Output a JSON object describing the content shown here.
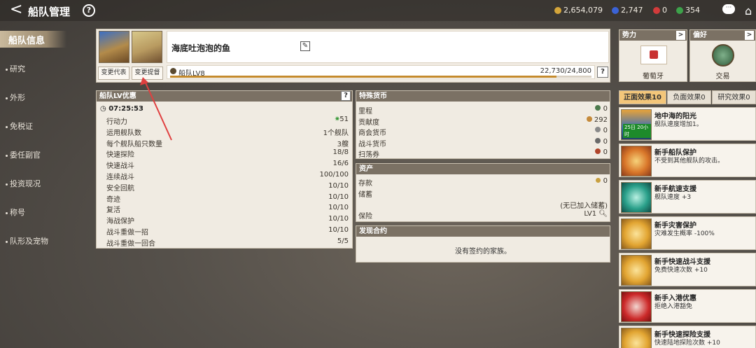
{
  "header": {
    "back_glyph": "<",
    "title": "船队管理",
    "help_glyph": "?",
    "currencies": [
      {
        "icon": "gold-coin-icon",
        "color": "#d4a53a",
        "value": "2,654,079"
      },
      {
        "icon": "blue-gem-icon",
        "color": "#3b63d6",
        "value": "2,747"
      },
      {
        "icon": "red-gem-icon",
        "color": "#d23b3b",
        "value": "0"
      },
      {
        "icon": "green-badge-icon",
        "color": "#3da24a",
        "value": "354"
      }
    ],
    "chat_glyph": "···",
    "home_glyph": "⌂"
  },
  "sidebar": {
    "active": "船队信息",
    "items": [
      "研究",
      "外形",
      "免税证",
      "委任副官",
      "投资现况",
      "称号",
      "队形及宠物"
    ]
  },
  "fleet": {
    "change_rep_label": "变更代表",
    "change_admiral_label": "变更提督",
    "name": "海底吐泡泡的鱼",
    "edit_glyph": "✎",
    "level_label": "船队LV8",
    "exp_value": "22,730/24,800",
    "exp_progress": 0.9165,
    "help_glyph": "?"
  },
  "lv_benefits": {
    "title": "船队LV优惠",
    "help_glyph": "?",
    "timer": "07:25:53",
    "rows": [
      {
        "k": "行动力",
        "v": "51"
      },
      {
        "k": "运用舰队数",
        "v": "1个舰队"
      },
      {
        "k": "每个舰队船只数量",
        "v": "3艘"
      },
      {
        "k": "快速探险",
        "v": "18/8"
      },
      {
        "k": "快速战斗",
        "v": "16/6"
      },
      {
        "k": "连续战斗",
        "v": "100/100"
      },
      {
        "k": "安全回航",
        "v": "10/10"
      },
      {
        "k": "奇迹",
        "v": "10/10"
      },
      {
        "k": "复活",
        "v": "10/10"
      },
      {
        "k": "海战保护",
        "v": "10/10"
      },
      {
        "k": "战斗重做一招",
        "v": "10/10"
      },
      {
        "k": "战斗重做一回合",
        "v": "5/5"
      }
    ]
  },
  "special_currency": {
    "title": "特殊货币",
    "rows": [
      {
        "k": "里程",
        "v": "0",
        "icon": "mileage-icon",
        "color": "#4c7a4c"
      },
      {
        "k": "贡献度",
        "v": "292",
        "icon": "scroll-icon",
        "color": "#c58a3a"
      },
      {
        "k": "商会货币",
        "v": "0",
        "icon": "guild-coin-icon",
        "color": "#8a8a8a"
      },
      {
        "k": "战斗货币",
        "v": "0",
        "icon": "battle-coin-icon",
        "color": "#6a6a6a"
      },
      {
        "k": "扫荡券",
        "v": "0",
        "icon": "ticket-icon",
        "color": "#b0442a"
      }
    ]
  },
  "assets": {
    "title": "资产",
    "deposit_label": "存款",
    "deposit_value": "0",
    "savings_label": "储蓄",
    "savings_note": "(无已加入储蓄)",
    "insurance_label": "保险",
    "insurance_value": "LV1"
  },
  "contract": {
    "title": "发现合约",
    "empty": "没有签约的家族。"
  },
  "right_panel": {
    "faction_label": "势力",
    "faction_name": "葡萄牙",
    "preference_label": "偏好",
    "preference_name": "交易",
    "arrow_glyph": ">",
    "tabs": [
      "正面效果10",
      "负面效果0",
      "研究效果0"
    ],
    "effects": [
      {
        "title": "地中海的阳光",
        "desc": "舰队速度增加1。",
        "badge": "25日 20小时",
        "icon": "ship-sunset-icon"
      },
      {
        "title": "新手船队保护",
        "desc": "不受到其他舰队的攻击。",
        "icon": "shield-fist-icon"
      },
      {
        "title": "新手航速支援",
        "desc": "舰队速度 +3",
        "icon": "compass-star-icon"
      },
      {
        "title": "新手灾害保护",
        "desc": "灾难发生概率 -100%",
        "icon": "gold-shield-icon"
      },
      {
        "title": "新手快速战斗支援",
        "desc": "免费快速次数 +10",
        "icon": "gold-shield-icon"
      },
      {
        "title": "新手入港优惠",
        "desc": "拒绝入港豁免",
        "icon": "red-hood-icon"
      },
      {
        "title": "新手快速探险支援",
        "desc": "快速陆地探险次数 +10",
        "icon": "gold-shield-icon"
      }
    ]
  }
}
